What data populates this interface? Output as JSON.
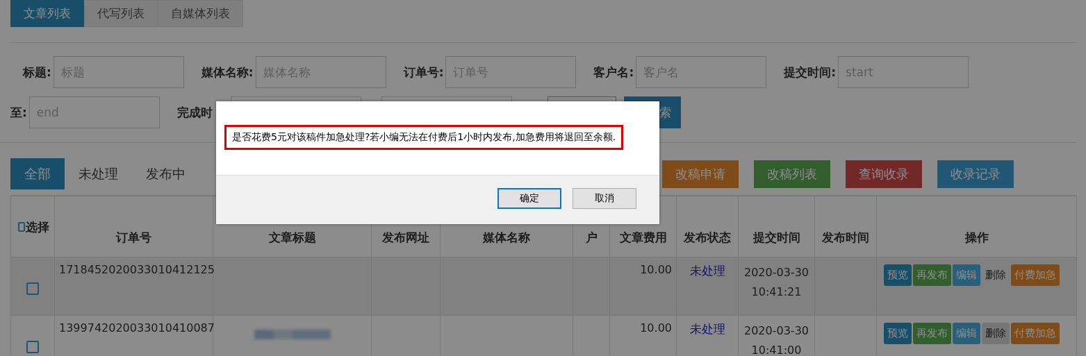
{
  "top_tabs": [
    {
      "label": "文章列表",
      "selected": true
    },
    {
      "label": "代写列表",
      "selected": false
    },
    {
      "label": "自媒体列表",
      "selected": false
    }
  ],
  "filters": [
    {
      "label": "标题:",
      "placeholder": "标题"
    },
    {
      "label": "媒体名称:",
      "placeholder": "媒体名称"
    },
    {
      "label": "订单号:",
      "placeholder": "订单号"
    },
    {
      "label": "客户名:",
      "placeholder": "客户名"
    },
    {
      "label": "提交时间:",
      "placeholder": "start"
    },
    {
      "label": "至:",
      "placeholder": "end"
    },
    {
      "label": "完成时"
    }
  ],
  "search_button": "索",
  "status_tabs": [
    {
      "label": "全部",
      "selected": true
    },
    {
      "label": "未处理",
      "selected": false
    },
    {
      "label": "发布中",
      "selected": false
    }
  ],
  "action_buttons": [
    {
      "label": "改稿申请",
      "kind": "warning"
    },
    {
      "label": "改稿列表",
      "kind": "success"
    },
    {
      "label": "查询收录",
      "kind": "danger"
    },
    {
      "label": "收录记录",
      "kind": "info"
    }
  ],
  "table": {
    "select_all_checked": false,
    "columns": [
      "选择",
      "订单号",
      "文章标题",
      "发布网址",
      "媒体名称",
      "户",
      "文章费用",
      "发布状态",
      "提交时间",
      "发布时间",
      "操作"
    ],
    "rows": [
      {
        "highlighted": true,
        "checked": false,
        "order": "1718452020033010412125",
        "fee": "10.00",
        "status": "未处理",
        "submitted": [
          "2020-03-30",
          "10:41:21"
        ],
        "title_blurred": false,
        "ops": [
          {
            "label": "预览",
            "kind": "primary"
          },
          {
            "label": "再发布",
            "kind": "success"
          },
          {
            "label": "编辑",
            "kind": "info"
          },
          {
            "label": "删除",
            "kind": "link"
          },
          {
            "label": "付费加急",
            "kind": "warning"
          }
        ]
      },
      {
        "highlighted": false,
        "checked": false,
        "order": "1399742020033010410087",
        "fee": "10.00",
        "status": "未处理",
        "submitted": [
          "2020-03-30",
          "10:41:00"
        ],
        "title_blurred": true,
        "ops": [
          {
            "label": "预览",
            "kind": "primary"
          },
          {
            "label": "再发布",
            "kind": "success"
          },
          {
            "label": "编辑",
            "kind": "info"
          },
          {
            "label": "删除",
            "kind": "default"
          },
          {
            "label": "付费加急",
            "kind": "warning"
          }
        ]
      }
    ]
  },
  "dialog": {
    "message": "是否花费5元对该稿件加急处理?若小编无法在付费后1小时内发布,加急费用将退回至余额.",
    "buttons": [
      {
        "label": "确定",
        "focused": true
      },
      {
        "label": "取消",
        "focused": false
      }
    ]
  }
}
